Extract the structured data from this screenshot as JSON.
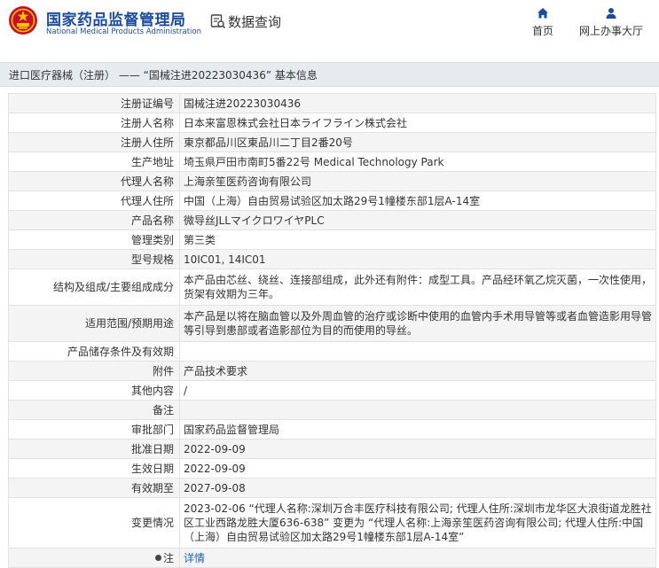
{
  "header": {
    "org_name_cn": "国家药品监督管理局",
    "org_name_en": "National Medical Products Administration",
    "data_query_label": "数据查询",
    "nav": [
      {
        "label": "首页",
        "icon": "home-icon"
      },
      {
        "label": "网上办事大厅",
        "icon": "user-icon"
      }
    ],
    "brand_color": "#1b4c9c"
  },
  "title_bar": {
    "text": "进口医疗器械（注册） —— “国械注进20223030436” 基本信息"
  },
  "rows": [
    {
      "label": "注册证编号",
      "value": "国械注进20223030436"
    },
    {
      "label": "注册人名称",
      "value": "日本来富恩株式会社日本ライフライン株式会社"
    },
    {
      "label": "注册人住所",
      "value": "東京都品川区東品川二丁目2番20号"
    },
    {
      "label": "生产地址",
      "value": "埼玉県戸田市南町5番22号 Medical Technology Park"
    },
    {
      "label": "代理人名称",
      "value": "上海亲笙医药咨询有限公司"
    },
    {
      "label": "代理人住所",
      "value": "中国（上海）自由贸易试验区加太路29号1幢楼东部1层A-14室"
    },
    {
      "label": "产品名称",
      "value": "微导丝JLLマイクロワイヤPLC"
    },
    {
      "label": "管理类别",
      "value": "第三类"
    },
    {
      "label": "型号规格",
      "value": "10IC01, 14IC01"
    },
    {
      "label": "结构及组成/主要组成成分",
      "value": "本产品由芯丝、绕丝、连接部组成，此外还有附件：成型工具。产品经环氧乙烷灭菌，一次性使用，货架有效期为三年。"
    },
    {
      "label": "适用范围/预期用途",
      "value": "本产品是以将在脑血管以及外周血管的治疗或诊断中使用的血管内手术用导管等或者血管造影用导管等引导到患部或者造影部位为目的而使用的导丝。"
    },
    {
      "label": "产品储存条件及有效期",
      "value": ""
    },
    {
      "label": "附件",
      "value": "产品技术要求"
    },
    {
      "label": "其他内容",
      "value": "/"
    },
    {
      "label": "备注",
      "value": ""
    },
    {
      "label": "审批部门",
      "value": "国家药品监督管理局"
    },
    {
      "label": "批准日期",
      "value": "2022-09-09"
    },
    {
      "label": "生效日期",
      "value": "2022-09-09"
    },
    {
      "label": "有效期至",
      "value": "2027-09-08"
    },
    {
      "label": "变更情况",
      "value": "2023-02-06 “代理人名称:深圳万合丰医疗科技有限公司; 代理人住所:深圳市龙华区大浪街道龙胜社区工业西路龙胜大厦636-638” 变更为 “代理人名称:上海亲笙医药咨询有限公司; 代理人住所:中国（上海）自由贸易试验区加太路29号1幢楼东部1层A-14室”"
    },
    {
      "label": "注",
      "value": "详情"
    }
  ]
}
